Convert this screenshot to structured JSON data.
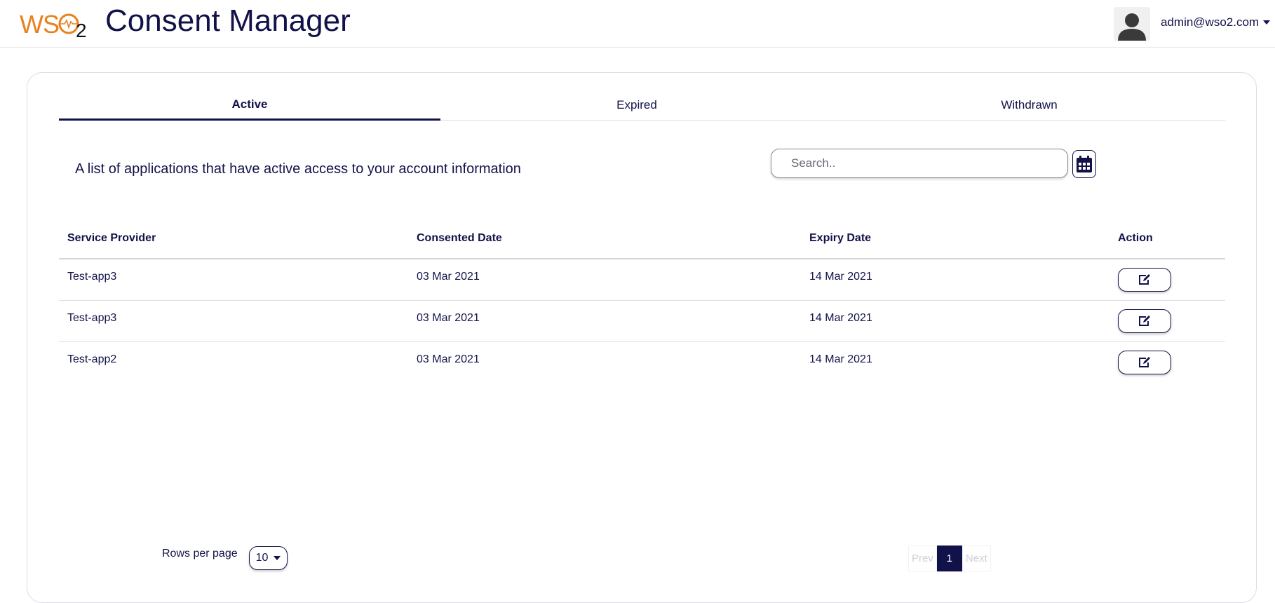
{
  "header": {
    "logo_text": "WS",
    "logo_sub": "2",
    "title": "Consent Manager",
    "user": "admin@wso2.com"
  },
  "tabs": [
    {
      "label": "Active",
      "active": true
    },
    {
      "label": "Expired",
      "active": false
    },
    {
      "label": "Withdrawn",
      "active": false
    }
  ],
  "description": "A list of applications that have active access to your account information",
  "search": {
    "placeholder": "Search..",
    "value": ""
  },
  "table": {
    "headers": [
      "Service Provider",
      "Consented Date",
      "Expiry Date",
      "Action"
    ],
    "rows": [
      {
        "service_provider": "Test-app3",
        "consented_date": "03 Mar 2021",
        "expiry_date": "14 Mar 2021"
      },
      {
        "service_provider": "Test-app3",
        "consented_date": "03 Mar 2021",
        "expiry_date": "14 Mar 2021"
      },
      {
        "service_provider": "Test-app2",
        "consented_date": "03 Mar 2021",
        "expiry_date": "14 Mar 2021"
      }
    ]
  },
  "footer": {
    "rows_per_page_label": "Rows per page",
    "rows_per_page_value": "10",
    "prev_label": "Prev",
    "current_page": "1",
    "next_label": "Next"
  },
  "colors": {
    "primary": "#12124a",
    "logo_orange": "#e8821e"
  },
  "icons": {
    "avatar": "user-avatar-icon",
    "calendar": "calendar-icon",
    "edit": "edit-icon",
    "caret": "chevron-down-icon"
  }
}
